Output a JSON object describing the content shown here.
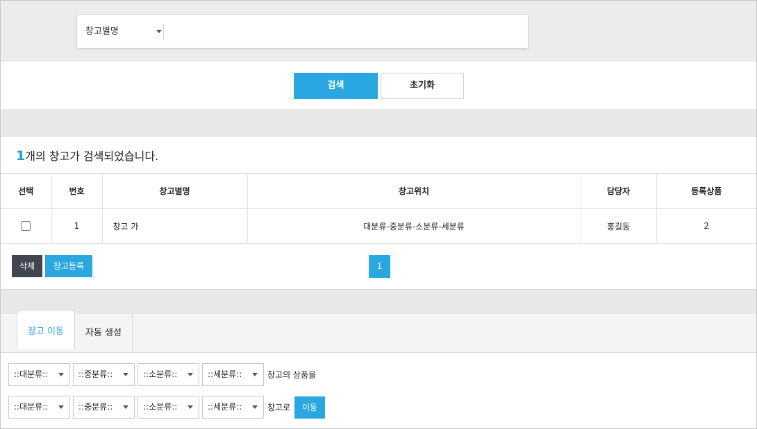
{
  "search": {
    "field_label": "창고별명",
    "query": "",
    "search_button": "검색",
    "reset_button": "초기화"
  },
  "result": {
    "count": "1",
    "message": "개의 창고가 검색되었습니다."
  },
  "table": {
    "headers": [
      "선택",
      "번호",
      "창고별명",
      "창고위치",
      "담당자",
      "등록상품"
    ],
    "rows": [
      {
        "checked": false,
        "number": "1",
        "name": "창고 가",
        "location": "대분류-중분류-소분류-세분류",
        "manager": "홍길동",
        "products": "2"
      }
    ]
  },
  "actions": {
    "delete_button": "삭제",
    "register_button": "창고등록"
  },
  "pagination": {
    "current_page": "1"
  },
  "tabs": [
    {
      "label": "창고 이동",
      "active": true
    },
    {
      "label": "자동 생성",
      "active": false
    }
  ],
  "move_form": {
    "source": {
      "selects": [
        "::대분류::",
        "::중분류::",
        "::소분류::",
        "::세분류::"
      ],
      "suffix": "창고의 상품을"
    },
    "target": {
      "selects": [
        "::대분류::",
        "::중분류::",
        "::소분류::",
        "::세분류::"
      ],
      "suffix": "창고로"
    },
    "move_button": "이동"
  },
  "colors": {
    "accent": "#29a7e1",
    "dark_button": "#3f4650",
    "band": "#ececec"
  }
}
